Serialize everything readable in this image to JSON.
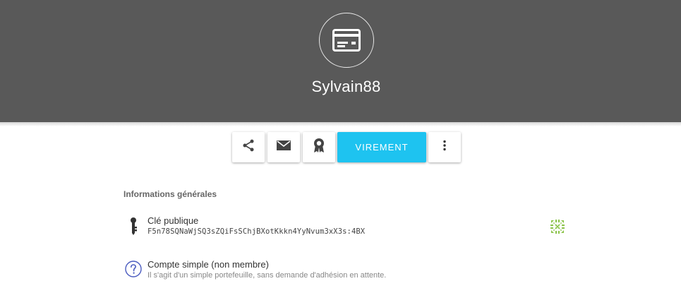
{
  "profile": {
    "name": "Sylvain88",
    "avatar_icon": "wallet-card-icon"
  },
  "actions": {
    "share_icon": "share-icon",
    "mail_icon": "mail-icon",
    "certify_icon": "certification-ribbon-icon",
    "transfer_label": "VIREMENT",
    "more_icon": "more-vertical-icon"
  },
  "general": {
    "title": "Informations générales",
    "pubkey": {
      "label": "Clé publique",
      "value": "F5n78SQNaWjSQ3sZQiFsSChjBXotKkkn4YyNvum3xX3s:4BX",
      "icon": "key-icon",
      "identicon": "identicon"
    },
    "account": {
      "label": "Compte simple (non membre)",
      "description": "Il s'agit d'un simple portefeuille, sans demande d'adhésion en attente.",
      "icon": "help-circle-icon"
    }
  },
  "colors": {
    "header": "#595959",
    "accent": "#1ec3f0",
    "identicon": "#8bc34a"
  }
}
